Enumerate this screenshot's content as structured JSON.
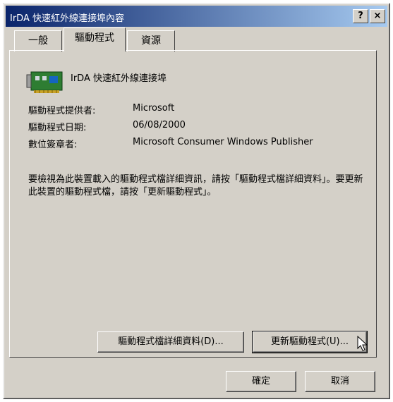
{
  "window": {
    "title": "IrDA 快速紅外線連接埠內容",
    "help_label": "?",
    "close_label": "×"
  },
  "tabs": [
    {
      "label": "一般",
      "active": false
    },
    {
      "label": "驅動程式",
      "active": true
    },
    {
      "label": "資源",
      "active": false
    }
  ],
  "device": {
    "name": "IrDA 快速紅外線連接埠",
    "icon": "network-card-icon"
  },
  "details": [
    {
      "label": "驅動程式提供者:",
      "value": "Microsoft"
    },
    {
      "label": "驅動程式日期:",
      "value": "06/08/2000"
    },
    {
      "label": "數位簽章者:",
      "value": "Microsoft Consumer Windows Publisher"
    }
  ],
  "description": "要檢視為此裝置載入的驅動程式檔詳細資訊，請按「驅動程式檔詳細資料」。要更新此裝置的驅動程式檔，請按「更新驅動程式」。",
  "buttons": {
    "driver_details": "驅動程式檔詳細資料(D)...",
    "update_driver": "更新驅動程式(U)...",
    "ok": "確定",
    "cancel": "取消"
  },
  "colors": {
    "title_start": "#0a246a",
    "title_end": "#a6caf0",
    "face": "#d4d0c8",
    "card_green": "#1f8a3a"
  }
}
